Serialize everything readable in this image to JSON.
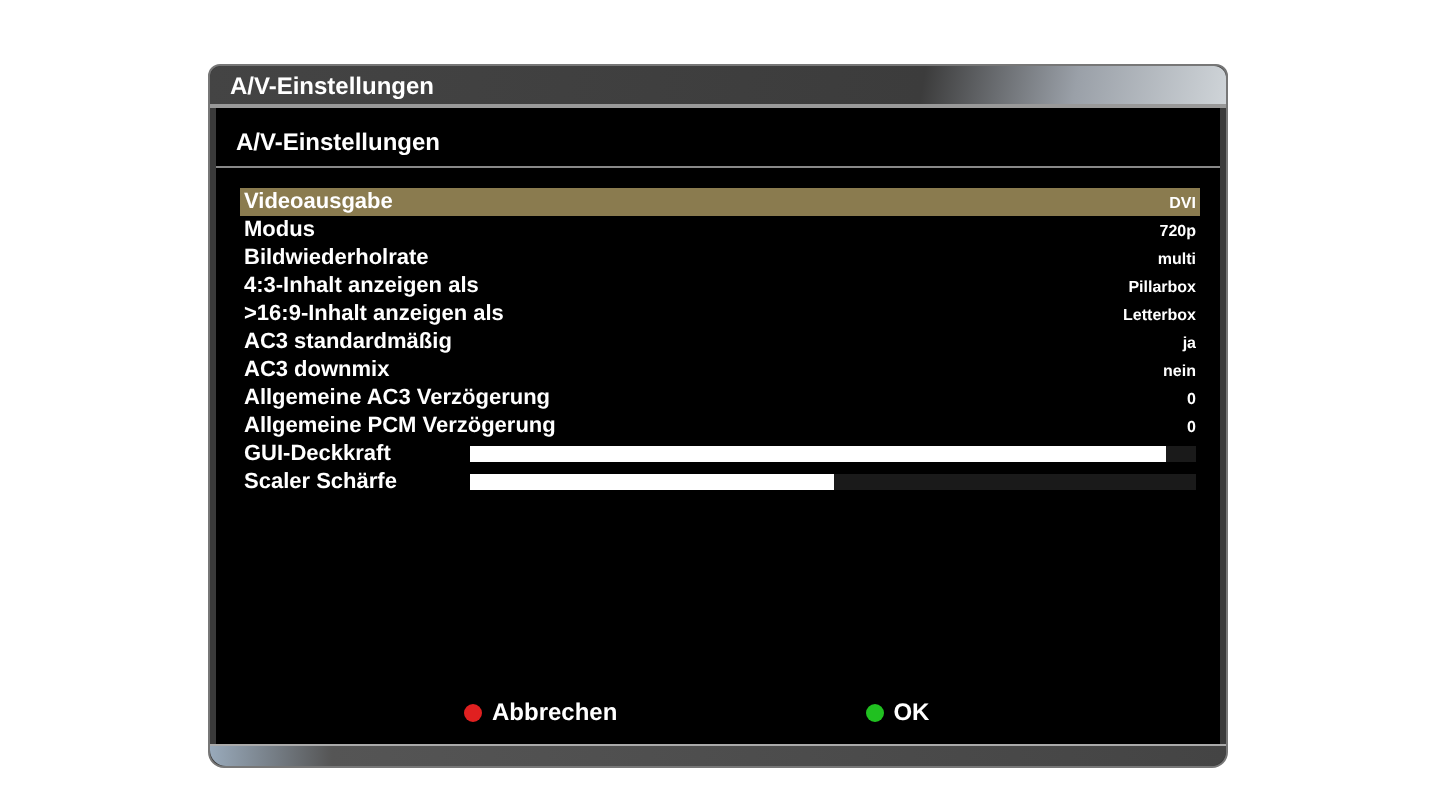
{
  "window": {
    "title": "A/V-Einstellungen"
  },
  "header": {
    "title": "A/V-Einstellungen"
  },
  "settings": [
    {
      "kind": "choice",
      "label": "Videoausgabe",
      "value": "DVI",
      "selected": true
    },
    {
      "kind": "choice",
      "label": "Modus",
      "value": "720p",
      "selected": false
    },
    {
      "kind": "choice",
      "label": "Bildwiederholrate",
      "value": "multi",
      "selected": false
    },
    {
      "kind": "choice",
      "label": "4:3-Inhalt anzeigen als",
      "value": "Pillarbox",
      "selected": false
    },
    {
      "kind": "choice",
      "label": ">16:9-Inhalt anzeigen als",
      "value": "Letterbox",
      "selected": false
    },
    {
      "kind": "choice",
      "label": "AC3 standardmäßig",
      "value": "ja",
      "selected": false
    },
    {
      "kind": "choice",
      "label": "AC3 downmix",
      "value": "nein",
      "selected": false
    },
    {
      "kind": "choice",
      "label": "Allgemeine AC3 Verzögerung",
      "value": "0",
      "selected": false
    },
    {
      "kind": "choice",
      "label": "Allgemeine PCM Verzögerung",
      "value": "0",
      "selected": false
    },
    {
      "kind": "slider",
      "label": "GUI-Deckkraft",
      "level": 0.96,
      "selected": false
    },
    {
      "kind": "slider",
      "label": "Scaler Schärfe",
      "level": 0.5,
      "selected": false
    }
  ],
  "buttons": [
    {
      "label": "Abbrechen",
      "color": "#e02020"
    },
    {
      "label": "OK",
      "color": "#20c020"
    }
  ]
}
